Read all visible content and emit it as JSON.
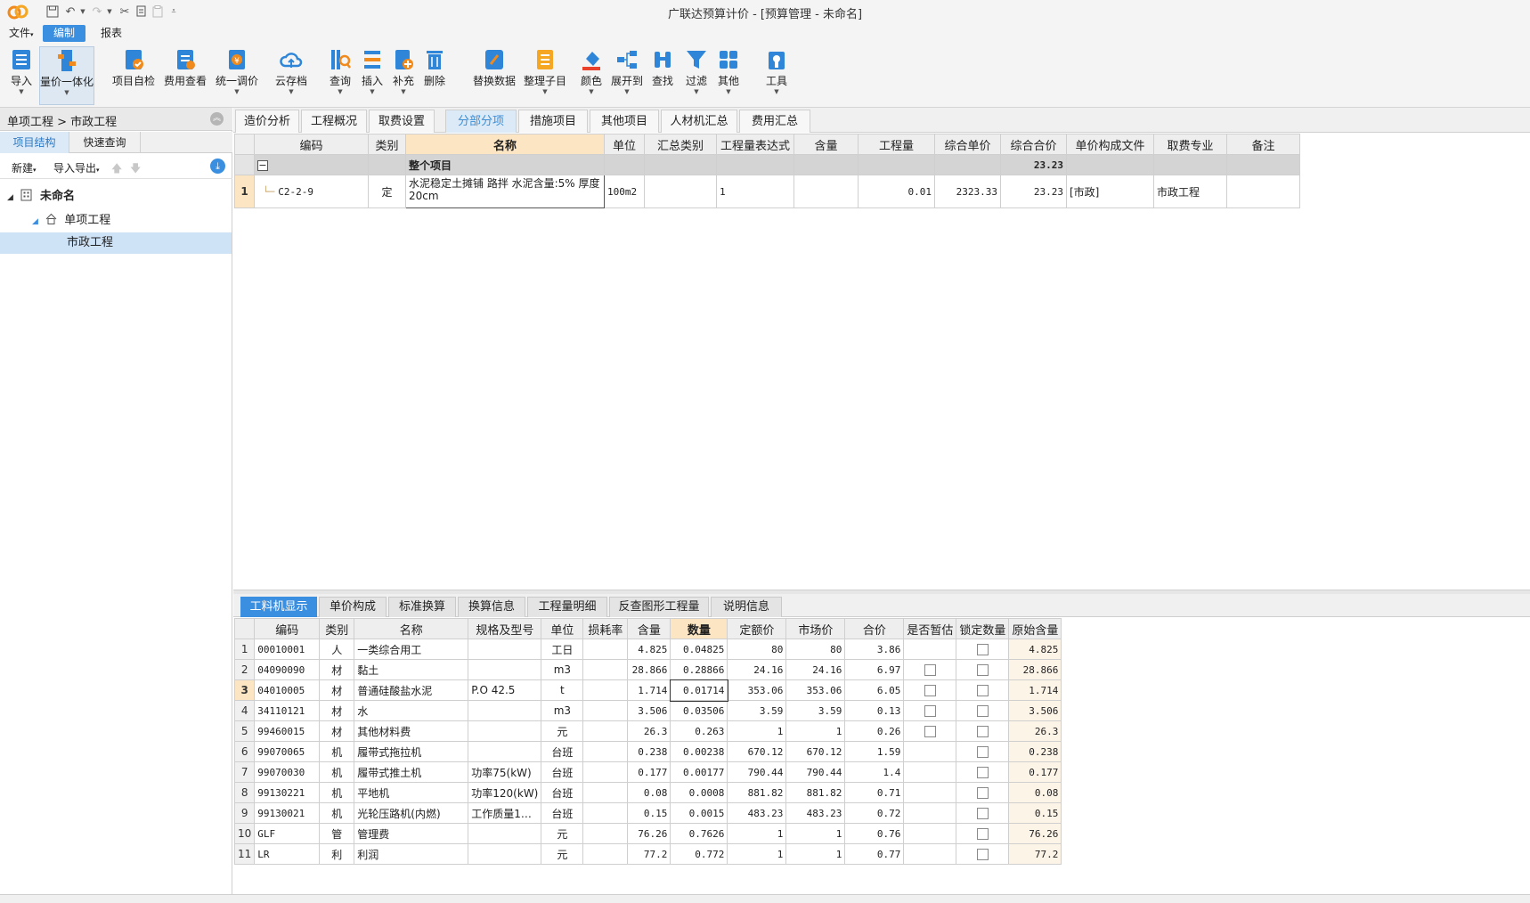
{
  "window": {
    "title": "广联达预算计价 - [预算管理 - 未命名]"
  },
  "menu": {
    "file": "文件",
    "edit": "编制",
    "report": "报表"
  },
  "ribbon": {
    "import": "导入",
    "price_integrate": "量价一体化",
    "project_check": "项目自检",
    "fee_view": "费用查看",
    "unify_adjust": "统一调价",
    "cloud_save": "云存档",
    "query": "查询",
    "insert": "插入",
    "supplement": "补充",
    "delete": "删除",
    "replace_data": "替换数据",
    "organize_items": "整理子目",
    "color": "颜色",
    "expand_to": "展开到",
    "find": "查找",
    "filter": "过滤",
    "other": "其他",
    "tools": "工具"
  },
  "left": {
    "breadcrumb": "单项工程 > 市政工程",
    "tabs": [
      "项目结构",
      "快速查询"
    ],
    "toolbar": {
      "new": "新建",
      "import_export": "导入导出"
    },
    "tree": {
      "root": "未命名",
      "child": "单项工程",
      "leaf": "市政工程"
    }
  },
  "main_tabs": [
    "造价分析",
    "工程概况",
    "取费设置",
    "分部分项",
    "措施项目",
    "其他项目",
    "人材机汇总",
    "费用汇总"
  ],
  "top_grid": {
    "headers": [
      "编码",
      "类别",
      "名称",
      "单位",
      "汇总类别",
      "工程量表达式",
      "含量",
      "工程量",
      "综合单价",
      "综合合价",
      "单价构成文件",
      "取费专业",
      "备注"
    ],
    "group": {
      "expander": "−",
      "name": "整个项目",
      "total": "23.23"
    },
    "row": {
      "no": "1",
      "code": "C2-2-9",
      "type": "定",
      "name": "水泥稳定土摊铺 路拌 水泥含量:5% 厚度20cm",
      "unit": "100m2",
      "summary_type": "",
      "qty_expr": "1",
      "content": "",
      "qty": "0.01",
      "unit_price": "2323.33",
      "total_price": "23.23",
      "price_file": "[市政]",
      "fee_specialty": "市政工程",
      "remark": ""
    }
  },
  "bottom_tabs": [
    "工料机显示",
    "单价构成",
    "标准换算",
    "换算信息",
    "工程量明细",
    "反查图形工程量",
    "说明信息"
  ],
  "bottom_grid": {
    "headers": [
      "编码",
      "类别",
      "名称",
      "规格及型号",
      "单位",
      "损耗率",
      "含量",
      "数量",
      "定额价",
      "市场价",
      "合价",
      "是否暂估",
      "锁定数量",
      "原始含量"
    ],
    "rows": [
      {
        "no": "1",
        "code": "00010001",
        "type": "人",
        "name": "一类综合用工",
        "spec": "",
        "unit": "工日",
        "loss": "",
        "content": "4.825",
        "qty": "0.04825",
        "quota": "80",
        "market": "80",
        "total": "3.86",
        "est": false,
        "orig": "4.825"
      },
      {
        "no": "2",
        "code": "04090090",
        "type": "材",
        "name": "黏土",
        "spec": "",
        "unit": "m3",
        "loss": "",
        "content": "28.866",
        "qty": "0.28866",
        "quota": "24.16",
        "market": "24.16",
        "total": "6.97",
        "est": true,
        "orig": "28.866"
      },
      {
        "no": "3",
        "code": "04010005",
        "type": "材",
        "name": "普通硅酸盐水泥",
        "spec": "P.O 42.5",
        "unit": "t",
        "loss": "",
        "content": "1.714",
        "qty": "0.01714",
        "quota": "353.06",
        "market": "353.06",
        "total": "6.05",
        "est": true,
        "orig": "1.714"
      },
      {
        "no": "4",
        "code": "34110121",
        "type": "材",
        "name": "水",
        "spec": "",
        "unit": "m3",
        "loss": "",
        "content": "3.506",
        "qty": "0.03506",
        "quota": "3.59",
        "market": "3.59",
        "total": "0.13",
        "est": true,
        "orig": "3.506"
      },
      {
        "no": "5",
        "code": "99460015",
        "type": "材",
        "name": "其他材料费",
        "spec": "",
        "unit": "元",
        "loss": "",
        "content": "26.3",
        "qty": "0.263",
        "quota": "1",
        "market": "1",
        "total": "0.26",
        "est": true,
        "orig": "26.3"
      },
      {
        "no": "6",
        "code": "99070065",
        "type": "机",
        "name": "履带式拖拉机",
        "spec": "",
        "unit": "台班",
        "loss": "",
        "content": "0.238",
        "qty": "0.00238",
        "quota": "670.12",
        "market": "670.12",
        "total": "1.59",
        "est": false,
        "orig": "0.238"
      },
      {
        "no": "7",
        "code": "99070030",
        "type": "机",
        "name": "履带式推土机",
        "spec": "功率75(kW)",
        "unit": "台班",
        "loss": "",
        "content": "0.177",
        "qty": "0.00177",
        "quota": "790.44",
        "market": "790.44",
        "total": "1.4",
        "est": false,
        "orig": "0.177"
      },
      {
        "no": "8",
        "code": "99130221",
        "type": "机",
        "name": "平地机",
        "spec": "功率120(kW)",
        "unit": "台班",
        "loss": "",
        "content": "0.08",
        "qty": "0.0008",
        "quota": "881.82",
        "market": "881.82",
        "total": "0.71",
        "est": false,
        "orig": "0.08"
      },
      {
        "no": "9",
        "code": "99130021",
        "type": "机",
        "name": "光轮压路机(内燃)",
        "spec": "工作质量1…",
        "unit": "台班",
        "loss": "",
        "content": "0.15",
        "qty": "0.0015",
        "quota": "483.23",
        "market": "483.23",
        "total": "0.72",
        "est": false,
        "orig": "0.15"
      },
      {
        "no": "10",
        "code": "GLF",
        "type": "管",
        "name": "管理费",
        "spec": "",
        "unit": "元",
        "loss": "",
        "content": "76.26",
        "qty": "0.7626",
        "quota": "1",
        "market": "1",
        "total": "0.76",
        "est": false,
        "orig": "76.26"
      },
      {
        "no": "11",
        "code": "LR",
        "type": "利",
        "name": "利润",
        "spec": "",
        "unit": "元",
        "loss": "",
        "content": "77.2",
        "qty": "0.772",
        "quota": "1",
        "market": "1",
        "total": "0.77",
        "est": false,
        "orig": "77.2"
      }
    ]
  },
  "colors": {
    "accent": "#3b8fe0",
    "highlight": "#fbe5c2",
    "group_row": "#d4d4d4"
  }
}
